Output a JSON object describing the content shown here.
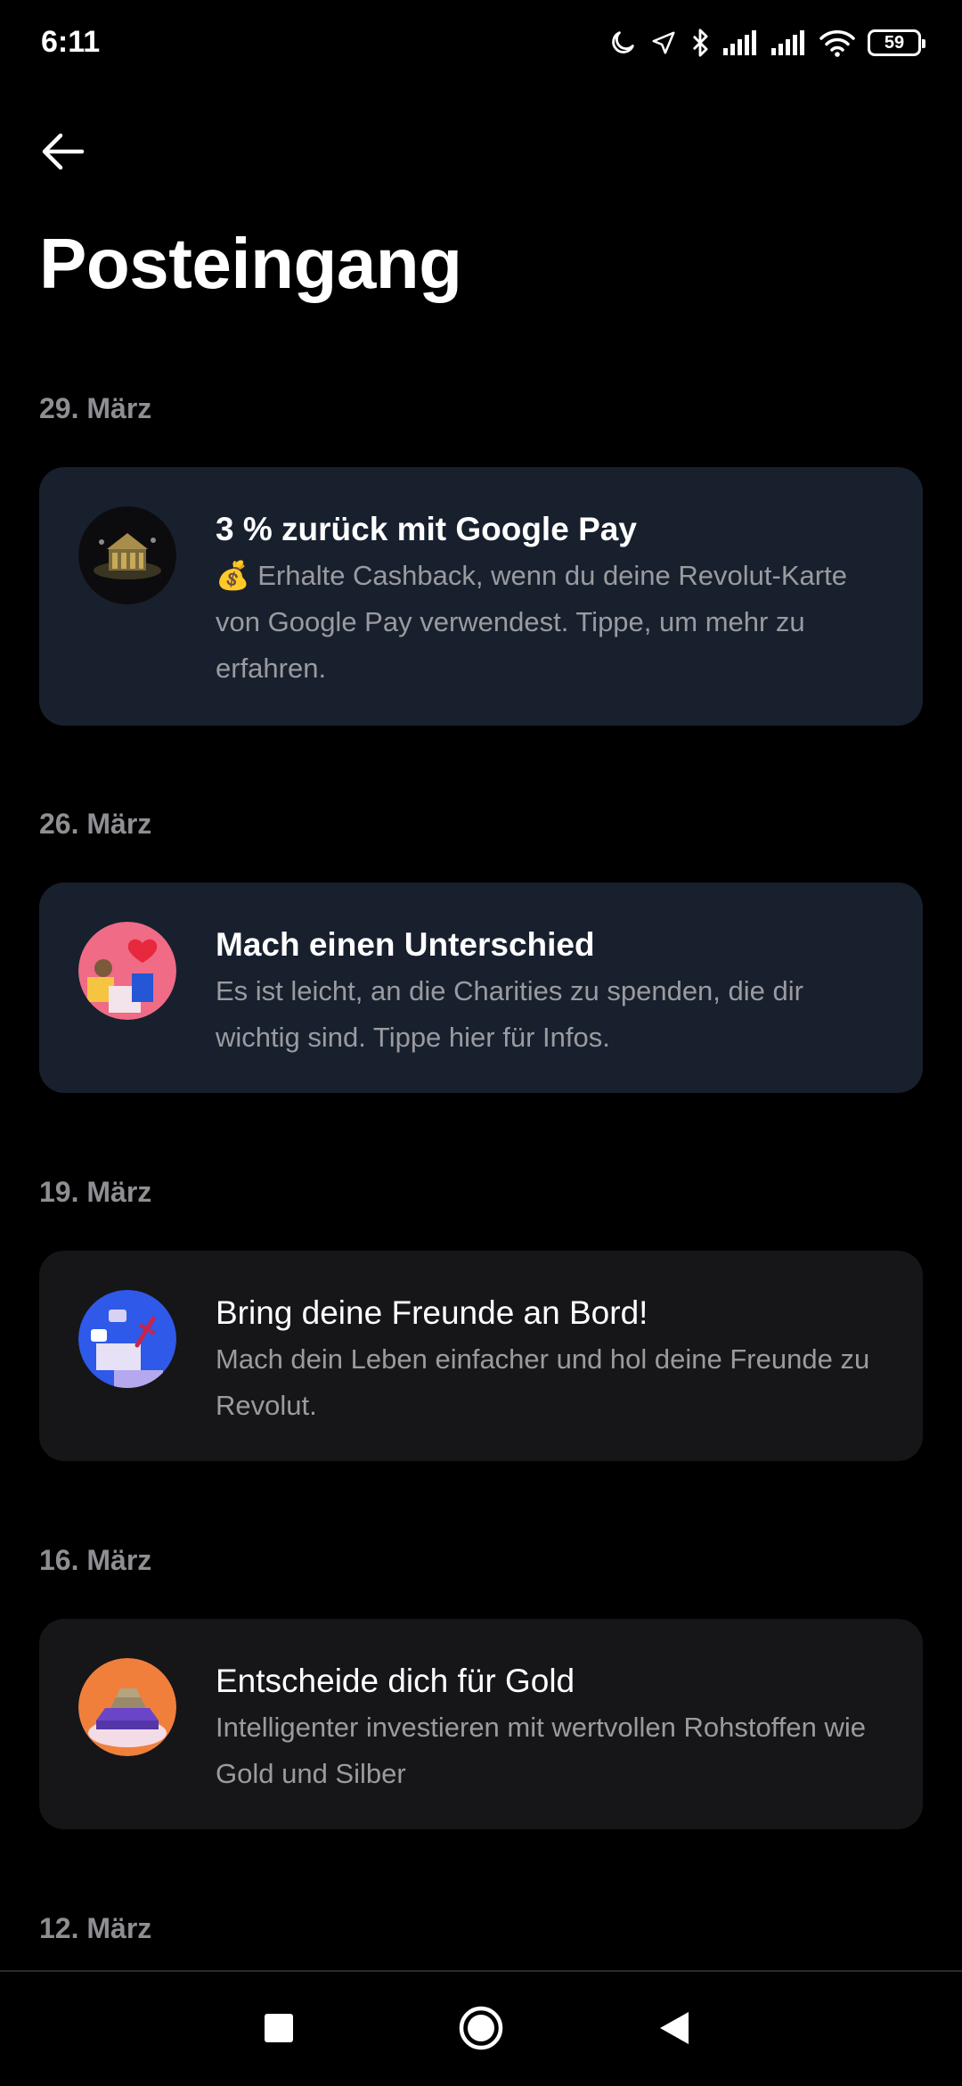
{
  "status_bar": {
    "time": "6:11",
    "battery": "59",
    "icons": [
      "moon-icon",
      "location-arrow-icon",
      "bluetooth-icon",
      "signal-icon",
      "signal-icon",
      "wifi-icon",
      "battery-icon"
    ]
  },
  "header": {
    "back_icon": "arrow-left-icon",
    "title": "Posteingang"
  },
  "colors": {
    "background": "#000000",
    "card_unread": "#18202e",
    "card_read": "#161618",
    "date_text": "#8e8e93",
    "body_text": "#9a9ba0"
  },
  "feed": [
    {
      "date": "29. März",
      "unread": true,
      "icon": "google-pay-cashback-icon",
      "title": "3 % zurück mit Google Pay",
      "body": "💰 Erhalte Cashback, wenn du deine Revolut-Karte von Google Pay verwendest. Tippe, um mehr zu erfahren."
    },
    {
      "date": "26. März",
      "unread": true,
      "icon": "charity-heart-icon",
      "title": "Mach einen Unterschied",
      "body": "Es ist leicht, an die Charities zu spenden, die dir wichtig sind. Tippe hier für Infos."
    },
    {
      "date": "19. März",
      "unread": false,
      "icon": "invite-friends-icon",
      "title": "Bring deine Freunde an Bord!",
      "body": "Mach dein Leben einfacher und hol deine Freunde zu Revolut."
    },
    {
      "date": "16. März",
      "unread": false,
      "icon": "gold-bars-icon",
      "title": "Entscheide dich für Gold",
      "body": "Intelligenter investieren mit wertvollen Rohstoffen wie Gold und Silber"
    },
    {
      "date": "12. März"
    }
  ],
  "nav_bar": {
    "items": [
      "recents-square-icon",
      "home-circle-icon",
      "back-triangle-icon"
    ]
  }
}
